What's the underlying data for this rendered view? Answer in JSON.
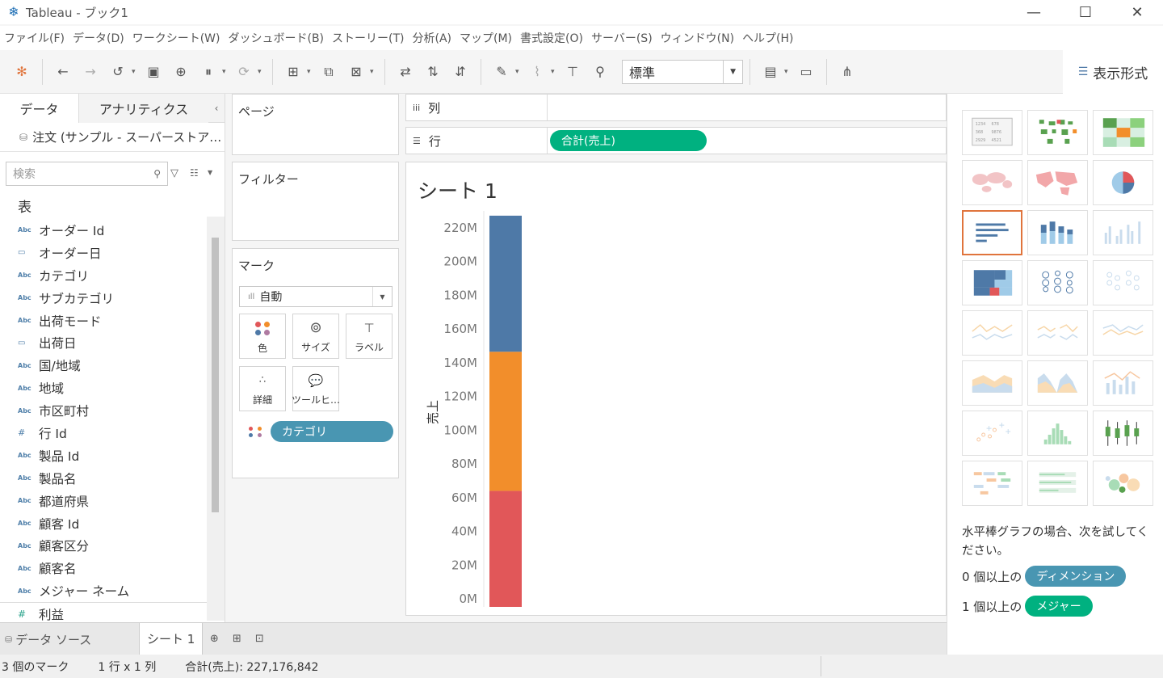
{
  "window": {
    "title": "Tableau - ブック1"
  },
  "menu": [
    "ファイル(F)",
    "データ(D)",
    "ワークシート(W)",
    "ダッシュボード(B)",
    "ストーリー(T)",
    "分析(A)",
    "マップ(M)",
    "書式設定(O)",
    "サーバー(S)",
    "ウィンドウ(N)",
    "ヘルプ(H)"
  ],
  "toolbar": {
    "fit": "標準",
    "showme_label": "表示形式"
  },
  "datapane": {
    "tab_data": "データ",
    "tab_analytics": "アナリティクス",
    "datasource": "注文 (サンプル - スーパーストア…",
    "search_placeholder": "検索",
    "section": "表",
    "fields": [
      {
        "type": "Abc",
        "name": "オーダー Id"
      },
      {
        "type": "date",
        "name": "オーダー日"
      },
      {
        "type": "Abc",
        "name": "カテゴリ"
      },
      {
        "type": "Abc",
        "name": "サブカテゴリ"
      },
      {
        "type": "Abc",
        "name": "出荷モード"
      },
      {
        "type": "date",
        "name": "出荷日"
      },
      {
        "type": "Abc",
        "name": "国/地域"
      },
      {
        "type": "Abc",
        "name": "地域"
      },
      {
        "type": "Abc",
        "name": "市区町村"
      },
      {
        "type": "#",
        "name": "行 Id"
      },
      {
        "type": "Abc",
        "name": "製品 Id"
      },
      {
        "type": "Abc",
        "name": "製品名"
      },
      {
        "type": "Abc",
        "name": "都道府県"
      },
      {
        "type": "Abc",
        "name": "顧客 Id"
      },
      {
        "type": "Abc",
        "name": "顧客区分"
      },
      {
        "type": "Abc",
        "name": "顧客名"
      },
      {
        "type": "Abc",
        "name": "メジャー ネーム"
      },
      {
        "type": "measure",
        "name": "利益"
      }
    ]
  },
  "shelves": {
    "pages": "ページ",
    "filters": "フィルター",
    "marks": "マーク",
    "mark_type": "自動",
    "mark_buttons": [
      "色",
      "サイズ",
      "ラベル",
      "詳細",
      "ツールヒ…"
    ],
    "color_pill": "カテゴリ",
    "columns_label": "列",
    "rows_label": "行",
    "rows_pill": "合計(売上)"
  },
  "view": {
    "sheet_title": "シート 1"
  },
  "chart_data": {
    "type": "bar",
    "stacked": true,
    "ylabel": "売上",
    "ylim": [
      0,
      230000000
    ],
    "yticks": [
      "0M",
      "20M",
      "40M",
      "60M",
      "80M",
      "100M",
      "120M",
      "140M",
      "160M",
      "180M",
      "200M",
      "220M"
    ],
    "ytick_values": [
      0,
      20000000,
      40000000,
      60000000,
      80000000,
      100000000,
      120000000,
      140000000,
      160000000,
      180000000,
      200000000,
      220000000
    ],
    "segments": [
      {
        "value": 64000000,
        "color": "#e15759"
      },
      {
        "value": 82500000,
        "color": "#f28e2b"
      },
      {
        "value": 80676842,
        "color": "#4e79a7"
      }
    ]
  },
  "showme": {
    "hint": "水平棒グラフの場合、次を試してください。",
    "req1_prefix": "0 個以上の",
    "req1_pill": "ディメンション",
    "req2_prefix": "1 個以上の",
    "req2_pill": "メジャー"
  },
  "tabs": {
    "datasource": "データ ソース",
    "sheet": "シート 1"
  },
  "status": {
    "marks": "3 個のマーク",
    "grid": "1 行 x 1 列",
    "sum": "合計(売上): 227,176,842"
  },
  "colors": {
    "dimension": "#4996b2",
    "measure": "#00b180",
    "selected": "#e0743c"
  }
}
